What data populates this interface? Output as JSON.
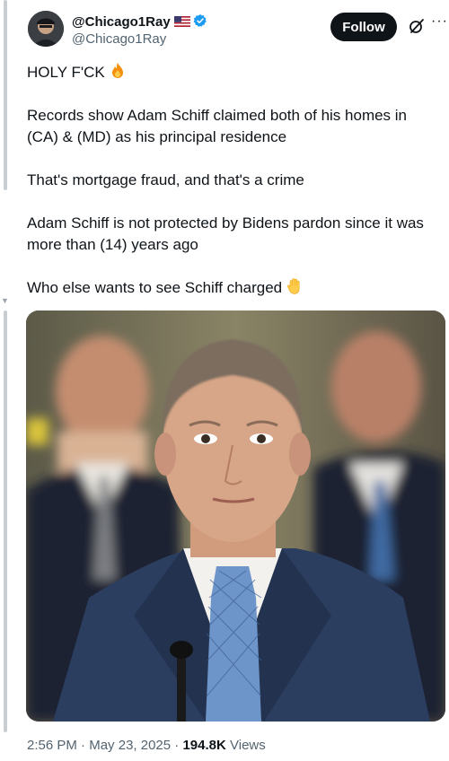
{
  "author": {
    "display_name": "@Chicago1Ray",
    "handle": "@Chicago1Ray",
    "avatar_icon": "avatar-icon",
    "flag_icon": "us-flag-icon",
    "verified_icon": "verified-badge-icon"
  },
  "actions": {
    "follow_label": "Follow",
    "grok_icon": "grok-icon",
    "more_label": "···"
  },
  "post": {
    "line1": "HOLY F'CK",
    "line1_emoji": "fire-emoji",
    "para2": "Records show Adam Schiff claimed both of his homes in (CA) & (MD) as his principal residence",
    "para3": "That's mortgage fraud, and that's a crime",
    "para4": "Adam Schiff is not protected by Bidens pardon since it was more than (14) years ago",
    "para5": "Who else wants to see Schiff charged",
    "para5_emoji": "raised-hand-emoji"
  },
  "media": {
    "kind": "photo"
  },
  "meta": {
    "time": "2:56 PM",
    "sep1": " · ",
    "date": "May 23, 2025",
    "sep2": " · ",
    "views_count": "194.8K",
    "views_label": " Views"
  },
  "colors": {
    "text": "#0f1419",
    "secondary": "#536471",
    "verified": "#1d9bf0",
    "button": "#0f1419"
  }
}
